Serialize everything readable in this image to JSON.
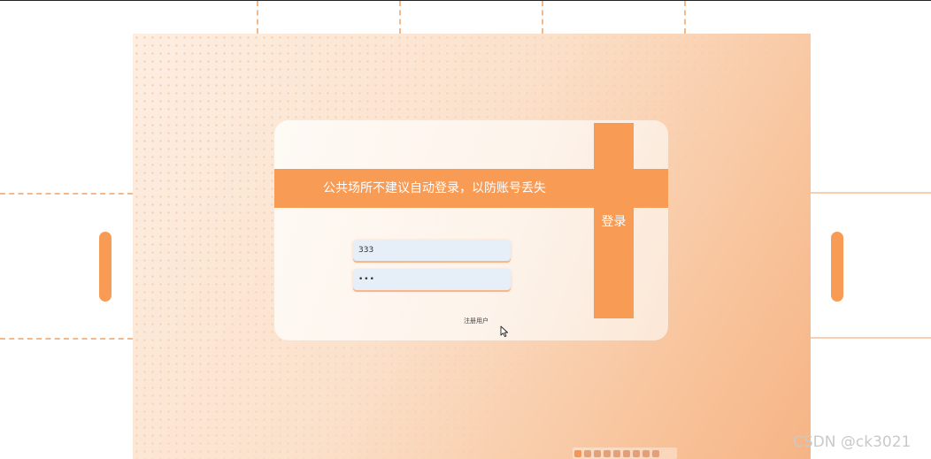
{
  "login_card": {
    "notice": "公共场所不建议自动登录，以防账号丢失",
    "login_button": "登录",
    "username_value": "333",
    "password_value": "333",
    "register_link": "注册用户"
  },
  "watermark": "CSDN @ck3021",
  "colors": {
    "accent": "#f89b55",
    "background_gradient_start": "#fdeee2",
    "background_gradient_end": "#f6b485",
    "input_background": "#e6eef8"
  },
  "icons": {
    "cursor": "mouse-pointer-icon",
    "decor": "side-pill"
  }
}
